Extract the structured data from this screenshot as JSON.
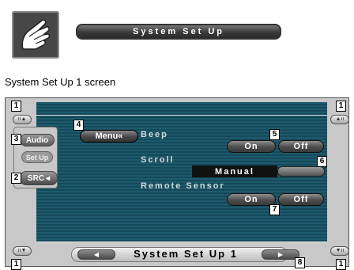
{
  "header": {
    "title": "System Set Up",
    "icon": "hand-pointer-icon"
  },
  "caption": "System Set Up 1 screen",
  "screen": {
    "menu_label": "Menu«",
    "beep": {
      "label": "Beep",
      "on": "On",
      "off": "Off"
    },
    "scroll": {
      "label": "Scroll",
      "value": "Manual"
    },
    "remote_sensor": {
      "label": "Remote Sensor",
      "on": "On",
      "off": "Off"
    },
    "left_panel": {
      "audio": "Audio",
      "setup": "Set Up",
      "src": "SRC"
    },
    "bottom_title": "System Set Up 1"
  },
  "callouts": {
    "c1": "1",
    "c2": "2",
    "c3": "3",
    "c4": "4",
    "c5": "5",
    "c6": "6",
    "c7": "7",
    "c8": "8"
  },
  "colors": {
    "panel": "#1c5b6d",
    "frame": "#c8c8c8"
  }
}
